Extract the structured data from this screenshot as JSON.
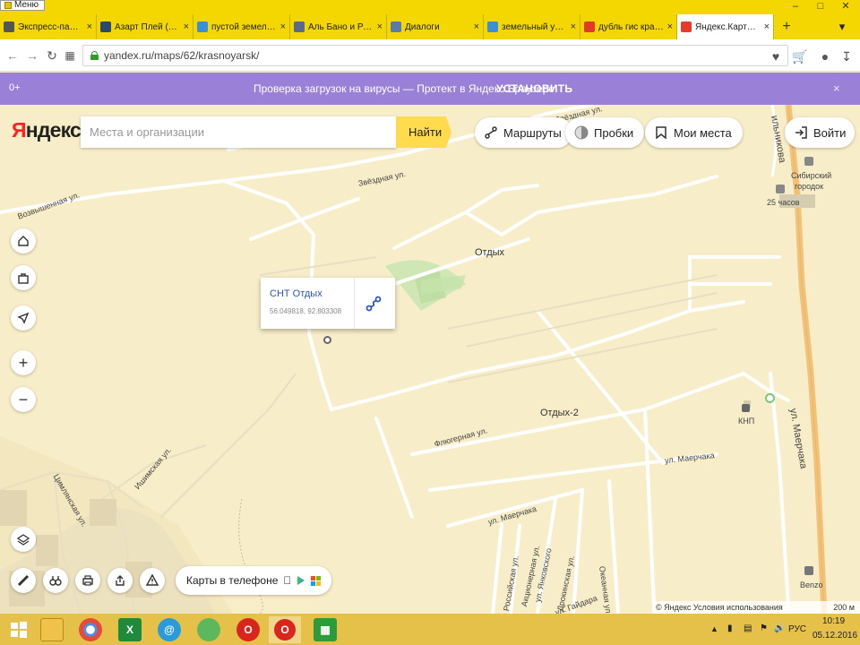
{
  "os": {
    "menu_label": "Меню"
  },
  "tabs": [
    {
      "label": "Экспресс-панель",
      "fav_color": "#555555"
    },
    {
      "label": "Азарт Плей (Azartplay)",
      "fav_color": "#2b4a6b"
    },
    {
      "label": "пустой земельный",
      "fav_color": "#3a8fd8"
    },
    {
      "label": "Аль Бано и Ромина",
      "fav_color": "#5a6a8a"
    },
    {
      "label": "Диалоги",
      "fav_color": "#5b7aa8"
    },
    {
      "label": "земельный участок",
      "fav_color": "#3a8fd8"
    },
    {
      "label": "дубль гис красноярск",
      "fav_color": "#e23a2a"
    },
    {
      "label": "Яндекс.Карты — поиск",
      "fav_color": "#e83a2a"
    }
  ],
  "tab_close_glyph": "×",
  "tab_new_glyph": "+",
  "address": {
    "url": "yandex.ru/maps/62/krasnoyarsk/"
  },
  "promo": {
    "age": "0+",
    "text": "Проверка загрузок на вирусы — Протект в Яндекс.Браузере",
    "install": "УСТАНОВИТЬ",
    "close": "×"
  },
  "header": {
    "logo_y": "Я",
    "logo_rest": "ндекс",
    "search_placeholder": "Места и организации",
    "search_button": "Найти",
    "routes": "Маршруты",
    "traffic": "Пробки",
    "my_places": "Мои места",
    "login": "Войти"
  },
  "popup": {
    "name": "СНТ Отдых",
    "coords": "56.049818, 92.803308"
  },
  "map_labels": {
    "otdyh": "Отдых",
    "otdyh2": "Отдых-2",
    "zvezdnaya": "Звёздная ул.",
    "vozvyshennaya": "Возвышенная ул.",
    "flyugernaya": "Флюгерная ул.",
    "ishimskaya": "Ишимская ул.",
    "tsimlyanskaya": "Цимлянская ул.",
    "maerchaka1": "ул. Маерчака",
    "maerchaka2": "ул. Маерчака",
    "maerchaka_big": "ул. Маерчака",
    "ilnikova": "ильникова",
    "sibirsky": "Сибирский",
    "gorodok": "городок",
    "hours25": "25 часов",
    "knp": "КНП",
    "benzo": "Benzo",
    "aktsionernaya": "Акционерная ул.",
    "yankovskogo": "ул. Янковского",
    "drokinskaya": "Дрокинская ул.",
    "okeanskaya": "Океанная ул.",
    "rossiyskaya": "Российская ул.",
    "gaidara": "ул. Гайдара",
    "zvezdnaya_top": "Звёздная ул."
  },
  "phone_pill": {
    "label": "Карты в телефоне"
  },
  "copyright": {
    "text": "© Яндекс Условия использования",
    "scale": "200 м"
  },
  "taskbar": {
    "lang": "РУС",
    "time": "10:19",
    "date": "05.12.2016"
  },
  "colors": {
    "browser_yellow": "#f4d600",
    "promo_purple": "#9b80d8",
    "yandex_red": "#ff2222",
    "search_yellow": "#ffdb4d",
    "link_blue": "#2e56b8",
    "map_bg": "#f7edc8",
    "road_orange": "#f2c27a"
  }
}
